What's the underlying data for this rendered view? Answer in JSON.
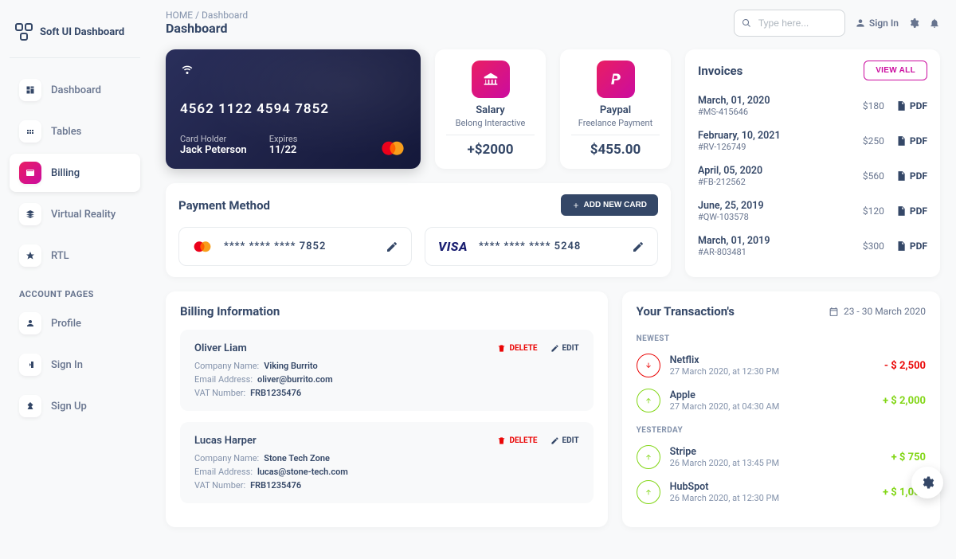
{
  "brand": {
    "name": "Soft UI Dashboard"
  },
  "breadcrumb": {
    "home": "HOME",
    "current": "Dashboard"
  },
  "page": {
    "title": "Dashboard"
  },
  "search": {
    "placeholder": "Type here..."
  },
  "top": {
    "sign_in": "Sign In"
  },
  "sidebar": {
    "items": [
      {
        "label": "Dashboard"
      },
      {
        "label": "Tables"
      },
      {
        "label": "Billing"
      },
      {
        "label": "Virtual Reality"
      },
      {
        "label": "RTL"
      }
    ],
    "account_section": "ACCOUNT PAGES",
    "account_items": [
      {
        "label": "Profile"
      },
      {
        "label": "Sign In"
      },
      {
        "label": "Sign Up"
      }
    ]
  },
  "credit_card": {
    "number": "4562   1122   4594   7852",
    "holder_label": "Card Holder",
    "holder": "Jack Peterson",
    "expires_label": "Expires",
    "expires": "11/22"
  },
  "stats": {
    "salary": {
      "title": "Salary",
      "subtitle": "Belong Interactive",
      "amount": "+$2000"
    },
    "paypal": {
      "title": "Paypal",
      "subtitle": "Freelance Payment",
      "amount": "$455.00"
    }
  },
  "invoices": {
    "title": "Invoices",
    "view_all": "VIEW ALL",
    "pdf": "PDF",
    "list": [
      {
        "date": "March, 01, 2020",
        "id": "#MS-415646",
        "amount": "$180"
      },
      {
        "date": "February, 10, 2021",
        "id": "#RV-126749",
        "amount": "$250"
      },
      {
        "date": "April, 05, 2020",
        "id": "#FB-212562",
        "amount": "$560"
      },
      {
        "date": "June, 25, 2019",
        "id": "#QW-103578",
        "amount": "$120"
      },
      {
        "date": "March, 01, 2019",
        "id": "#AR-803481",
        "amount": "$300"
      }
    ]
  },
  "payment": {
    "title": "Payment Method",
    "add": "ADD NEW CARD",
    "cards": [
      {
        "brand": "mastercard",
        "masked": "****   ****   ****   7852"
      },
      {
        "brand": "visa",
        "masked": "****   ****   ****   5248"
      }
    ]
  },
  "billing": {
    "title": "Billing Information",
    "delete": "DELETE",
    "edit": "EDIT",
    "labels": {
      "company": "Company Name:",
      "email": "Email Address:",
      "vat": "VAT Number:"
    },
    "items": [
      {
        "name": "Oliver Liam",
        "company": "Viking Burrito",
        "email": "oliver@burrito.com",
        "vat": "FRB1235476"
      },
      {
        "name": "Lucas Harper",
        "company": "Stone Tech Zone",
        "email": "lucas@stone-tech.com",
        "vat": "FRB1235476"
      }
    ]
  },
  "transactions": {
    "title": "Your Transaction's",
    "range": "23 - 30 March 2020",
    "newest": "NEWEST",
    "yesterday": "YESTERDAY",
    "list_newest": [
      {
        "name": "Netflix",
        "time": "27 March 2020, at 12:30 PM",
        "amount": "- $ 2,500",
        "dir": "down"
      },
      {
        "name": "Apple",
        "time": "27 March 2020, at 04:30 AM",
        "amount": "+ $ 2,000",
        "dir": "up"
      }
    ],
    "list_yesterday": [
      {
        "name": "Stripe",
        "time": "26 March 2020, at 13:45 PM",
        "amount": "+ $ 750",
        "dir": "up"
      },
      {
        "name": "HubSpot",
        "time": "26 March 2020, at 12:30 PM",
        "amount": "+ $ 1,000",
        "dir": "up"
      }
    ]
  }
}
